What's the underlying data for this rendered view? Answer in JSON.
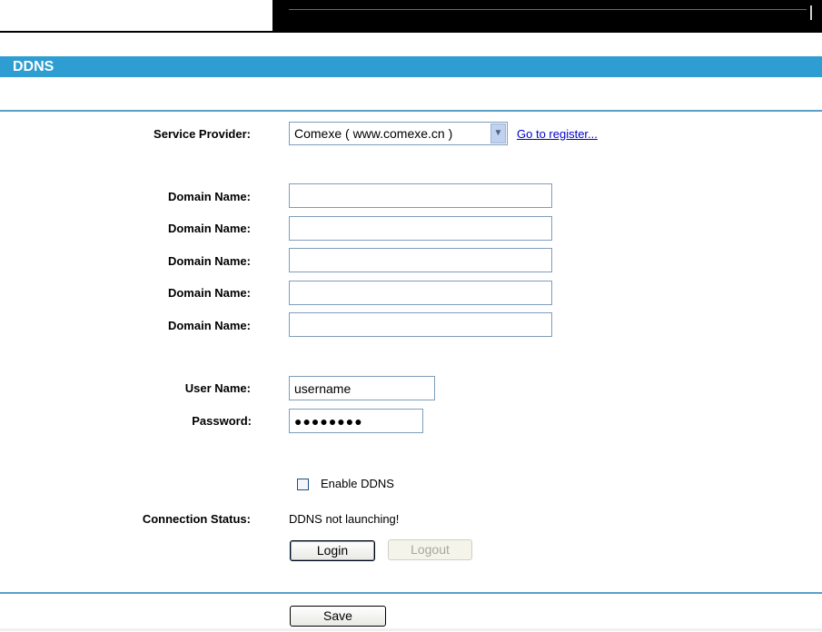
{
  "section": {
    "title": "DDNS"
  },
  "service_provider": {
    "label": "Service Provider:",
    "selected": "Comexe ( www.comexe.cn )",
    "register_link": "Go to register..."
  },
  "domains": {
    "label": "Domain Name:",
    "values": [
      "",
      "",
      "",
      "",
      ""
    ]
  },
  "username": {
    "label": "User Name:",
    "value": "username"
  },
  "password": {
    "label": "Password:",
    "value": "●●●●●●●●"
  },
  "enable_ddns": {
    "label": "Enable DDNS",
    "checked": false
  },
  "connection_status": {
    "label": "Connection Status:",
    "value": "DDNS not launching!"
  },
  "buttons": {
    "login": "Login",
    "logout": "Logout",
    "save": "Save"
  },
  "colors": {
    "header_bg": "#2d9dd2",
    "rule": "#5aa0c8",
    "link": "#0000cc"
  }
}
